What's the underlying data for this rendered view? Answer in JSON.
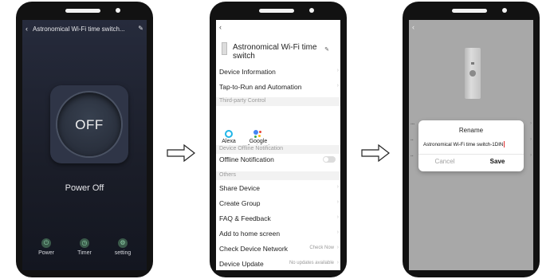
{
  "phone1": {
    "title": "Astronomical Wi-Fi time switch...",
    "back_icon": "chevron-left-icon",
    "edit_icon": "pencil-icon",
    "button_label": "OFF",
    "status": "Power Off",
    "bottom_nav": [
      {
        "label": "Power",
        "icon": "power-icon"
      },
      {
        "label": "Timer",
        "icon": "timer-icon"
      },
      {
        "label": "setting",
        "icon": "settings-icon"
      }
    ]
  },
  "phone2": {
    "device_name": "Astronomical Wi-Fi time switch",
    "menu": {
      "device_information": "Device Information",
      "tap_to_run": "Tap-to-Run and Automation"
    },
    "sections": {
      "third_party": "Third-party Control",
      "offline": "Device Offline Notification",
      "others": "Others"
    },
    "assistants": {
      "alexa": "Alexa",
      "google": "Google Assistant"
    },
    "offline_notification": "Offline Notification",
    "others_items": {
      "share": "Share Device",
      "create_group": "Create Group",
      "faq": "FAQ & Feedback",
      "add_home": "Add to home screen",
      "check_network": "Check Device Network",
      "device_update": "Device Update"
    },
    "values": {
      "check_now": "Check Now",
      "no_updates": "No updates available"
    }
  },
  "phone3": {
    "dialog": {
      "title": "Rename",
      "input_value": "Astronomical Wi-Fi time switch-1DIN",
      "cancel": "Cancel",
      "save": "Save"
    }
  },
  "colors": {
    "phone_body": "#121212",
    "phone1_bg": "#1c202c",
    "overlay": "#a8a8a8",
    "alexa_blue": "#20b5e8"
  }
}
